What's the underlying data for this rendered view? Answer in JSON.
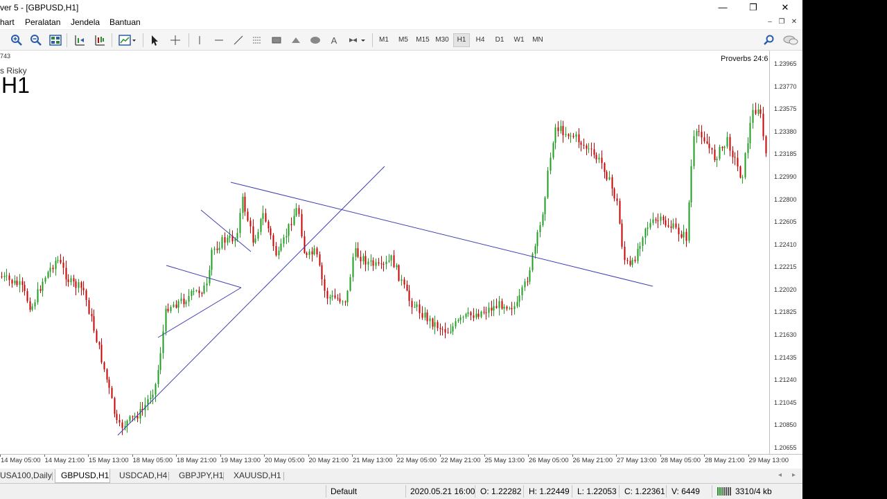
{
  "window": {
    "title": "ver 5 - [GBPUSD,H1]",
    "controls": {
      "minimize": "—",
      "maximize": "❐",
      "close": "✕"
    }
  },
  "menu": [
    "hart",
    "Peralatan",
    "Jendela",
    "Bantuan"
  ],
  "mdi_controls": [
    "‒",
    "❐",
    "✕"
  ],
  "toolbar": {
    "timeframes": [
      "M1",
      "M5",
      "M15",
      "M30",
      "H1",
      "H4",
      "D1",
      "W1",
      "MN"
    ],
    "active_timeframe": "H1",
    "text_tool": "A"
  },
  "chart": {
    "symbol_fragment": "743",
    "subtitle": "s Risky",
    "period": "H1",
    "watermark_text": "Proverbs 24:6",
    "bull_color": "#1e9e1e",
    "bear_color": "#c80000",
    "line_color": "#3f3fb0"
  },
  "price_scale": [
    "1.23965",
    "1.23770",
    "1.23575",
    "1.23380",
    "1.23185",
    "1.22990",
    "1.22800",
    "1.22605",
    "1.22410",
    "1.22215",
    "1.22020",
    "1.21825",
    "1.21630",
    "1.21435",
    "1.21240",
    "1.21045",
    "1.20850",
    "1.20655"
  ],
  "time_scale": [
    "14 May 05:00",
    "14 May 21:00",
    "15 May 13:00",
    "18 May 05:00",
    "18 May 21:00",
    "19 May 13:00",
    "20 May 05:00",
    "20 May 21:00",
    "21 May 13:00",
    "22 May 05:00",
    "22 May 21:00",
    "25 May 13:00",
    "26 May 05:00",
    "26 May 21:00",
    "27 May 13:00",
    "28 May 05:00",
    "28 May 21:00",
    "29 May 13:00"
  ],
  "tabs": [
    "USA100,Daily",
    "GBPUSD,H1",
    "USDCAD,H4",
    "GBPJPY,H1",
    "XAUUSD,H1"
  ],
  "active_tab": "GBPUSD,H1",
  "tab_scroll": {
    "left": "◂",
    "right": "▸"
  },
  "status": {
    "profile": "Default",
    "datetime": "2020.05.21 16:00",
    "open": "O: 1.22282",
    "high": "H: 1.22449",
    "low": "L: 1.22053",
    "close": "C: 1.22361",
    "volume": "V: 6449",
    "traffic": "3310/4 kb"
  }
}
